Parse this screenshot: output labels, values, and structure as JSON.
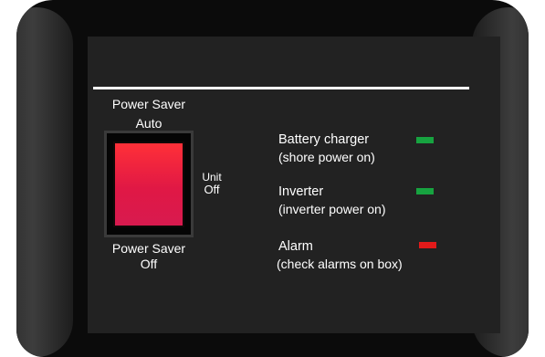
{
  "panel": {
    "switch": {
      "top_label_line1": "Power Saver",
      "top_label_line2": "Auto",
      "bottom_label_line1": "Power Saver",
      "bottom_label_line2": "Off",
      "side_label_line1": "Unit",
      "side_label_line2": "Off"
    },
    "indicators": [
      {
        "title": "Battery charger",
        "subtitle": "(shore power on)",
        "led_color": "#17a340"
      },
      {
        "title": "Inverter",
        "subtitle": "(inverter power on)",
        "led_color": "#17a340"
      },
      {
        "title": "Alarm",
        "subtitle": "(check alarms on box)",
        "led_color": "#e21a1a"
      }
    ]
  },
  "colors": {
    "body": "#0b0b0b",
    "screen": "#222222",
    "rocker": "#e01845"
  }
}
